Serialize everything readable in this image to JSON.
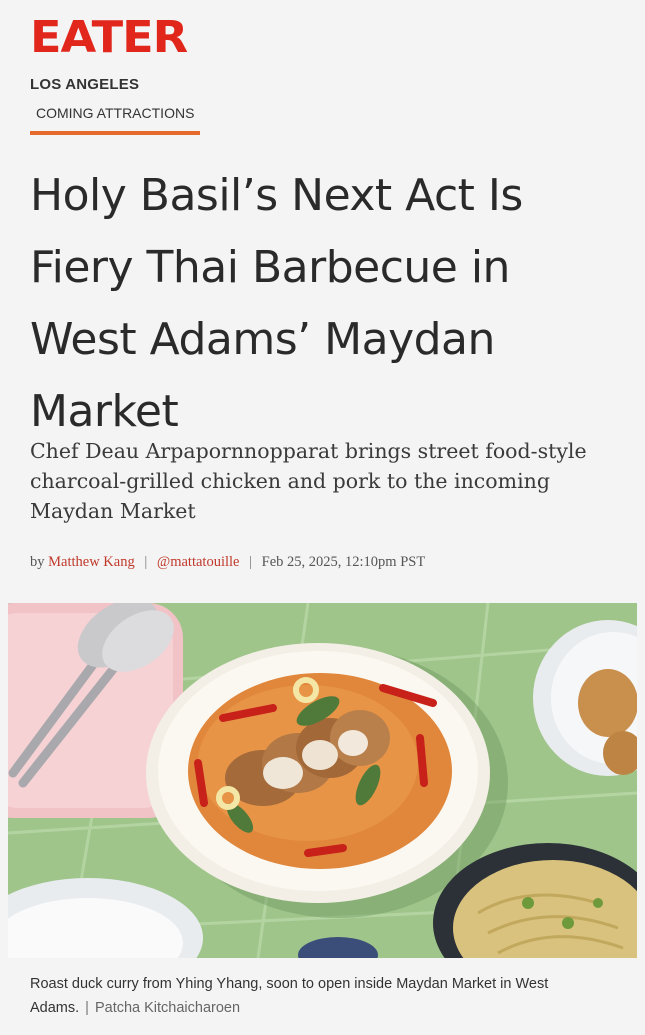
{
  "header": {
    "logo": "EATER",
    "region": "LOS ANGELES",
    "section": "COMING ATTRACTIONS"
  },
  "article": {
    "headline": "Holy Basil’s Next Act Is Fiery Thai Barbecue in West Adams’ Maydan Market",
    "dek": "Chef Deau Arpapornnopparat brings street food-style charcoal-grilled chicken and pork to the incoming Maydan Market",
    "byline": {
      "prefix": "by",
      "author": "Matthew Kang",
      "handle": "@mattatouille",
      "date": "Feb 25, 2025, 12:10pm PST"
    },
    "image": {
      "caption": "Roast duck curry from Yhing Yhang, soon to open inside Maydan Market in West Adams.",
      "credit": "Patcha Kitchaicharoen"
    }
  },
  "colors": {
    "brand_red": "#e1261c",
    "section_underline": "#e56a2c",
    "link": "#c0392b",
    "tile_green": "#9ec48a"
  }
}
